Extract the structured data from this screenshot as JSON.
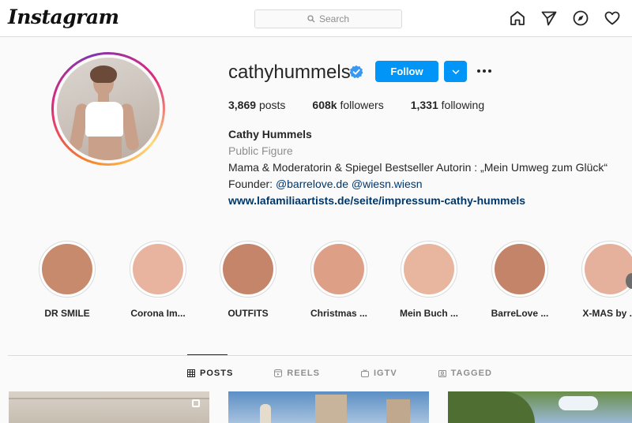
{
  "header": {
    "logo": "Instagram",
    "search_placeholder": "Search",
    "icons": [
      "home-icon",
      "direct-icon",
      "explore-icon",
      "activity-icon"
    ]
  },
  "profile": {
    "username": "cathyhummels",
    "verified": true,
    "follow_label": "Follow",
    "stats": {
      "posts_count": "3,869",
      "posts_label": "posts",
      "followers_count": "608k",
      "followers_label": "followers",
      "following_count": "1,331",
      "following_label": "following"
    },
    "bio": {
      "full_name": "Cathy Hummels",
      "category": "Public Figure",
      "line1": "Mama & Moderatorin & Spiegel Bestseller Autorin : „Mein Umweg zum Glück“",
      "founder_prefix": "Founder: ",
      "mention1": "@barrelove.de",
      "mention2": "@wiesn.wiesn",
      "website": "www.lafamiliaartists.de/seite/impressum-cathy-hummels"
    }
  },
  "highlights": [
    {
      "label": "DR SMILE",
      "color": "#c88a6c"
    },
    {
      "label": "Corona Im...",
      "color": "#e8b4a0"
    },
    {
      "label": "OUTFITS",
      "color": "#c4856a"
    },
    {
      "label": "Christmas ...",
      "color": "#dd9f86"
    },
    {
      "label": "Mein Buch ...",
      "color": "#e8b59f"
    },
    {
      "label": "BarreLove ...",
      "color": "#c3846a"
    },
    {
      "label": "X-MAS by ...",
      "color": "#e5b09c"
    }
  ],
  "tabs": [
    {
      "label": "POSTS",
      "icon": "grid-icon",
      "active": true
    },
    {
      "label": "REELS",
      "icon": "reels-icon",
      "active": false
    },
    {
      "label": "IGTV",
      "icon": "igtv-icon",
      "active": false
    },
    {
      "label": "TAGGED",
      "icon": "tagged-icon",
      "active": false
    }
  ],
  "colors": {
    "accent": "#0095f6",
    "link": "#00376b",
    "verified": "#3897f0"
  }
}
